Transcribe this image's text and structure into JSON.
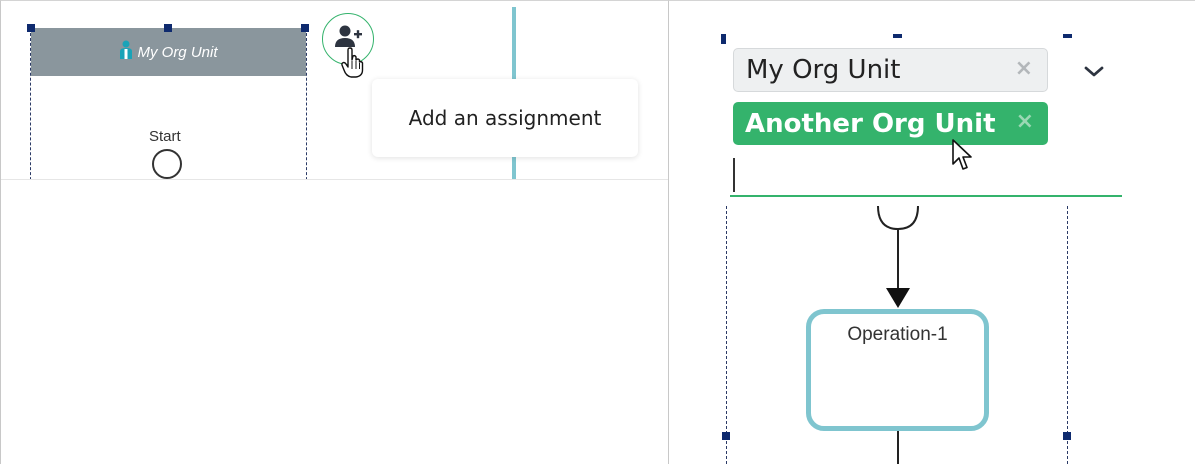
{
  "left": {
    "lane_title": "My Org Unit",
    "start_label": "Start",
    "tooltip_text": "Add an assignment",
    "add_button_icon": "add-user-icon"
  },
  "right": {
    "tags": [
      {
        "label": "My Org Unit",
        "state": "default"
      },
      {
        "label": "Another Org Unit",
        "state": "hovered"
      }
    ],
    "remove_icon": "×",
    "dropdown_icon": "chevron-down-icon",
    "task_label": "Operation-1"
  },
  "colors": {
    "accent_green": "#34b36c",
    "lane_header": "#8a969d",
    "task_border": "#7fc5cf",
    "selection": "#0e2a6e"
  }
}
